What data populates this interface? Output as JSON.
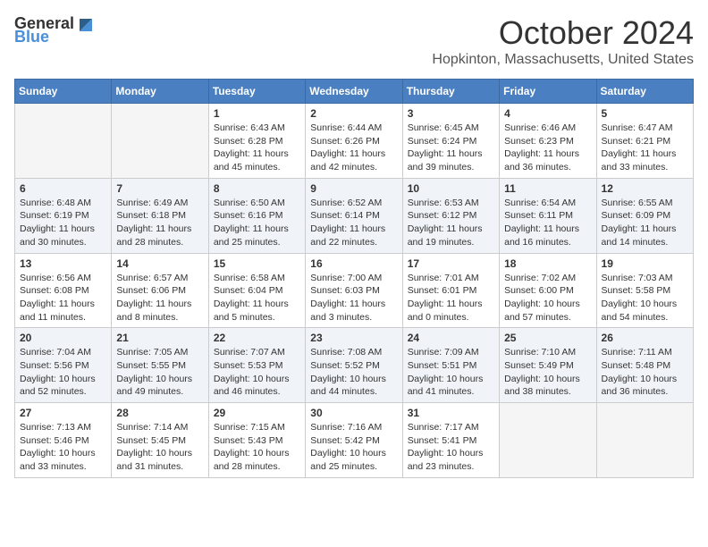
{
  "header": {
    "logo": {
      "general": "General",
      "blue": "Blue"
    },
    "title": "October 2024",
    "location": "Hopkinton, Massachusetts, United States"
  },
  "days_of_week": [
    "Sunday",
    "Monday",
    "Tuesday",
    "Wednesday",
    "Thursday",
    "Friday",
    "Saturday"
  ],
  "weeks": [
    [
      {
        "day": "",
        "info": ""
      },
      {
        "day": "",
        "info": ""
      },
      {
        "day": "1",
        "info": "Sunrise: 6:43 AM\nSunset: 6:28 PM\nDaylight: 11 hours and 45 minutes."
      },
      {
        "day": "2",
        "info": "Sunrise: 6:44 AM\nSunset: 6:26 PM\nDaylight: 11 hours and 42 minutes."
      },
      {
        "day": "3",
        "info": "Sunrise: 6:45 AM\nSunset: 6:24 PM\nDaylight: 11 hours and 39 minutes."
      },
      {
        "day": "4",
        "info": "Sunrise: 6:46 AM\nSunset: 6:23 PM\nDaylight: 11 hours and 36 minutes."
      },
      {
        "day": "5",
        "info": "Sunrise: 6:47 AM\nSunset: 6:21 PM\nDaylight: 11 hours and 33 minutes."
      }
    ],
    [
      {
        "day": "6",
        "info": "Sunrise: 6:48 AM\nSunset: 6:19 PM\nDaylight: 11 hours and 30 minutes."
      },
      {
        "day": "7",
        "info": "Sunrise: 6:49 AM\nSunset: 6:18 PM\nDaylight: 11 hours and 28 minutes."
      },
      {
        "day": "8",
        "info": "Sunrise: 6:50 AM\nSunset: 6:16 PM\nDaylight: 11 hours and 25 minutes."
      },
      {
        "day": "9",
        "info": "Sunrise: 6:52 AM\nSunset: 6:14 PM\nDaylight: 11 hours and 22 minutes."
      },
      {
        "day": "10",
        "info": "Sunrise: 6:53 AM\nSunset: 6:12 PM\nDaylight: 11 hours and 19 minutes."
      },
      {
        "day": "11",
        "info": "Sunrise: 6:54 AM\nSunset: 6:11 PM\nDaylight: 11 hours and 16 minutes."
      },
      {
        "day": "12",
        "info": "Sunrise: 6:55 AM\nSunset: 6:09 PM\nDaylight: 11 hours and 14 minutes."
      }
    ],
    [
      {
        "day": "13",
        "info": "Sunrise: 6:56 AM\nSunset: 6:08 PM\nDaylight: 11 hours and 11 minutes."
      },
      {
        "day": "14",
        "info": "Sunrise: 6:57 AM\nSunset: 6:06 PM\nDaylight: 11 hours and 8 minutes."
      },
      {
        "day": "15",
        "info": "Sunrise: 6:58 AM\nSunset: 6:04 PM\nDaylight: 11 hours and 5 minutes."
      },
      {
        "day": "16",
        "info": "Sunrise: 7:00 AM\nSunset: 6:03 PM\nDaylight: 11 hours and 3 minutes."
      },
      {
        "day": "17",
        "info": "Sunrise: 7:01 AM\nSunset: 6:01 PM\nDaylight: 11 hours and 0 minutes."
      },
      {
        "day": "18",
        "info": "Sunrise: 7:02 AM\nSunset: 6:00 PM\nDaylight: 10 hours and 57 minutes."
      },
      {
        "day": "19",
        "info": "Sunrise: 7:03 AM\nSunset: 5:58 PM\nDaylight: 10 hours and 54 minutes."
      }
    ],
    [
      {
        "day": "20",
        "info": "Sunrise: 7:04 AM\nSunset: 5:56 PM\nDaylight: 10 hours and 52 minutes."
      },
      {
        "day": "21",
        "info": "Sunrise: 7:05 AM\nSunset: 5:55 PM\nDaylight: 10 hours and 49 minutes."
      },
      {
        "day": "22",
        "info": "Sunrise: 7:07 AM\nSunset: 5:53 PM\nDaylight: 10 hours and 46 minutes."
      },
      {
        "day": "23",
        "info": "Sunrise: 7:08 AM\nSunset: 5:52 PM\nDaylight: 10 hours and 44 minutes."
      },
      {
        "day": "24",
        "info": "Sunrise: 7:09 AM\nSunset: 5:51 PM\nDaylight: 10 hours and 41 minutes."
      },
      {
        "day": "25",
        "info": "Sunrise: 7:10 AM\nSunset: 5:49 PM\nDaylight: 10 hours and 38 minutes."
      },
      {
        "day": "26",
        "info": "Sunrise: 7:11 AM\nSunset: 5:48 PM\nDaylight: 10 hours and 36 minutes."
      }
    ],
    [
      {
        "day": "27",
        "info": "Sunrise: 7:13 AM\nSunset: 5:46 PM\nDaylight: 10 hours and 33 minutes."
      },
      {
        "day": "28",
        "info": "Sunrise: 7:14 AM\nSunset: 5:45 PM\nDaylight: 10 hours and 31 minutes."
      },
      {
        "day": "29",
        "info": "Sunrise: 7:15 AM\nSunset: 5:43 PM\nDaylight: 10 hours and 28 minutes."
      },
      {
        "day": "30",
        "info": "Sunrise: 7:16 AM\nSunset: 5:42 PM\nDaylight: 10 hours and 25 minutes."
      },
      {
        "day": "31",
        "info": "Sunrise: 7:17 AM\nSunset: 5:41 PM\nDaylight: 10 hours and 23 minutes."
      },
      {
        "day": "",
        "info": ""
      },
      {
        "day": "",
        "info": ""
      }
    ]
  ]
}
